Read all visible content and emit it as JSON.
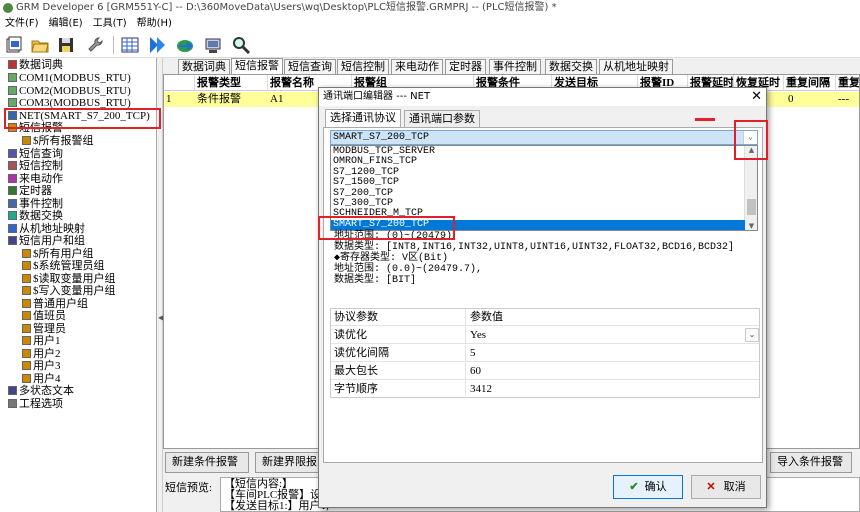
{
  "window": {
    "title": "GRM Developer 6 [GRM551Y-C]  -- D:\\360MoveData\\Users\\wq\\Desktop\\PLC短信报警.GRMPRJ -- (PLC短信报警) *"
  },
  "menu": [
    "文件(F)",
    "编辑(E)",
    "工具(T)",
    "帮助(H)"
  ],
  "toolbar": {
    "icons": [
      "new-icon",
      "open-icon",
      "save-icon",
      "wrench-icon",
      "grid-icon",
      "run-icon",
      "upload-icon",
      "download-icon",
      "search-icon"
    ]
  },
  "tree": {
    "items": [
      {
        "label": "数据词典",
        "indent": 0
      },
      {
        "label": "COM1(MODBUS_RTU)",
        "indent": 0
      },
      {
        "label": "COM2(MODBUS_RTU)",
        "indent": 0
      },
      {
        "label": "COM3(MODBUS_RTU)",
        "indent": 0
      },
      {
        "label": "NET(SMART_S7_200_TCP)",
        "indent": 0
      },
      {
        "label": "短信报警",
        "indent": 0
      },
      {
        "label": "$所有报警组",
        "indent": 1
      },
      {
        "label": "短信查询",
        "indent": 0
      },
      {
        "label": "短信控制",
        "indent": 0
      },
      {
        "label": "来电动作",
        "indent": 0
      },
      {
        "label": "定时器",
        "indent": 0
      },
      {
        "label": "事件控制",
        "indent": 0
      },
      {
        "label": "数据交换",
        "indent": 0
      },
      {
        "label": "从机地址映射",
        "indent": 0
      },
      {
        "label": "短信用户和组",
        "indent": 0
      },
      {
        "label": "$所有用户组",
        "indent": 1
      },
      {
        "label": "$系统管理员组",
        "indent": 1
      },
      {
        "label": "$读取变量用户组",
        "indent": 1
      },
      {
        "label": "$写入变量用户组",
        "indent": 1
      },
      {
        "label": "普通用户组",
        "indent": 1
      },
      {
        "label": "值班员",
        "indent": 1
      },
      {
        "label": "管理员",
        "indent": 1
      },
      {
        "label": "用户1",
        "indent": 1
      },
      {
        "label": "用户2",
        "indent": 1
      },
      {
        "label": "用户3",
        "indent": 1
      },
      {
        "label": "用户4",
        "indent": 1
      },
      {
        "label": "多状态文本",
        "indent": 0
      },
      {
        "label": "工程选项",
        "indent": 0
      }
    ]
  },
  "tabs": [
    "数据词典",
    "短信报警",
    "短信查询",
    "短信控制",
    "来电动作",
    "定时器",
    "事件控制",
    "数据交换",
    "从机地址映射"
  ],
  "grid": {
    "headers": [
      "报警类型",
      "报警名称",
      "报警组",
      "报警条件",
      "发送目标",
      "报警ID",
      "报警延时",
      "恢复延时",
      "重复间隔",
      "重复"
    ],
    "row": {
      "index": "1",
      "type": "条件报警",
      "name": "A1",
      "repeat": "0",
      "last": "---"
    }
  },
  "bottom_buttons": [
    "新建条件报警",
    "新建界限报",
    "导入条件报警"
  ],
  "preview": {
    "label": "短信预览:",
    "lines": [
      "【短信内容:】",
      "【车间PLC报警】设",
      "【发送目标1:】用户1;"
    ]
  },
  "dialog": {
    "title": "通讯端口编辑器 --- NET",
    "close": "✕",
    "tabs": [
      "选择通讯协议",
      "通讯端口参数"
    ],
    "selected": "SMART_S7_200_TCP",
    "options": [
      "MODBUS_TCP_SERVER",
      "OMRON_FINS_TCP",
      "S7_1200_TCP",
      "S7_1500_TCP",
      "S7_200_TCP",
      "S7_300_TCP",
      "SCHNEIDER_M_TCP",
      "SMART_S7_200_TCP"
    ],
    "info": [
      "地址范围: (0)~(20479)",
      "数据类型: [INT8,INT16,INT32,UINT8,UINT16,UINT32,FLOAT32,BCD16,BCD32]",
      "◆寄存器类型: V区(Bit)",
      "地址范围: (0.0)~(20479.7),",
      "数据类型: [BIT]"
    ],
    "param_header": [
      "协议参数",
      "参数值"
    ],
    "params": [
      {
        "name": "读优化",
        "value": "Yes"
      },
      {
        "name": "读优化间隔",
        "value": "5"
      },
      {
        "name": "最大包长",
        "value": "60"
      },
      {
        "name": "字节顺序",
        "value": "3412"
      }
    ],
    "ok": "确认",
    "cancel": "取消"
  },
  "colors": {
    "highlight": "#e0202a",
    "selection": "#0078d7",
    "row": "#ffff99"
  }
}
